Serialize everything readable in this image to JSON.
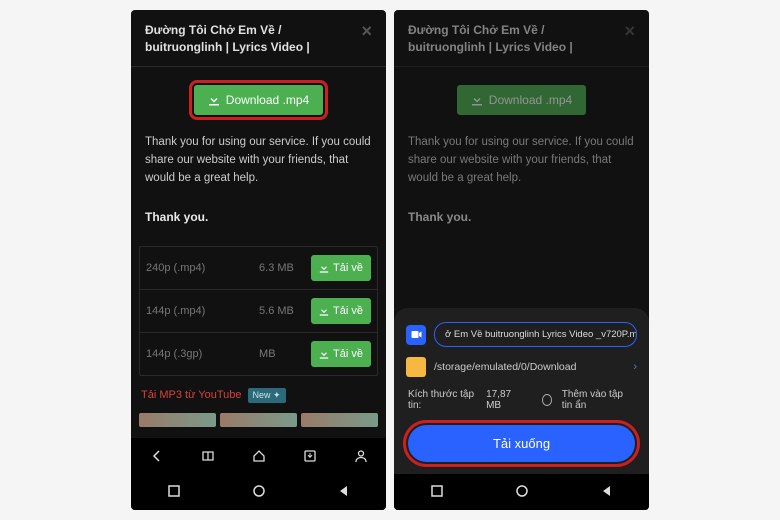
{
  "left": {
    "title": "Đường Tôi Chở Em Về / buitruonglinh | Lyrics Video |",
    "download_btn": "Download .mp4",
    "thank_text": "Thank you for using our service. If you could share our website with your friends, that would be a great help.",
    "thank_bold": "Thank you.",
    "rows": [
      {
        "format": "240p (.mp4)",
        "size": "6.3 MB",
        "btn": "Tải về"
      },
      {
        "format": "144p (.mp4)",
        "size": "5.6 MB",
        "btn": "Tải về"
      },
      {
        "format": "144p (.3gp)",
        "size": "MB",
        "btn": "Tải về"
      }
    ],
    "mp3_link": "Tải MP3 từ YouTube",
    "new_badge": "New"
  },
  "right": {
    "title": "Đường Tôi Chở Em Về / buitruonglinh | Lyrics Video |",
    "download_btn": "Download .mp4",
    "sheet": {
      "filename": "ở Em Về  buitruonglinh  Lyrics Video _v720P.m",
      "path": "/storage/emulated/0/Download",
      "size_label": "Kích thước tập tin:",
      "size_value": "17,87 MB",
      "hide_label": "Thêm vào tập tin ẩn",
      "dl_btn": "Tải xuống"
    }
  }
}
